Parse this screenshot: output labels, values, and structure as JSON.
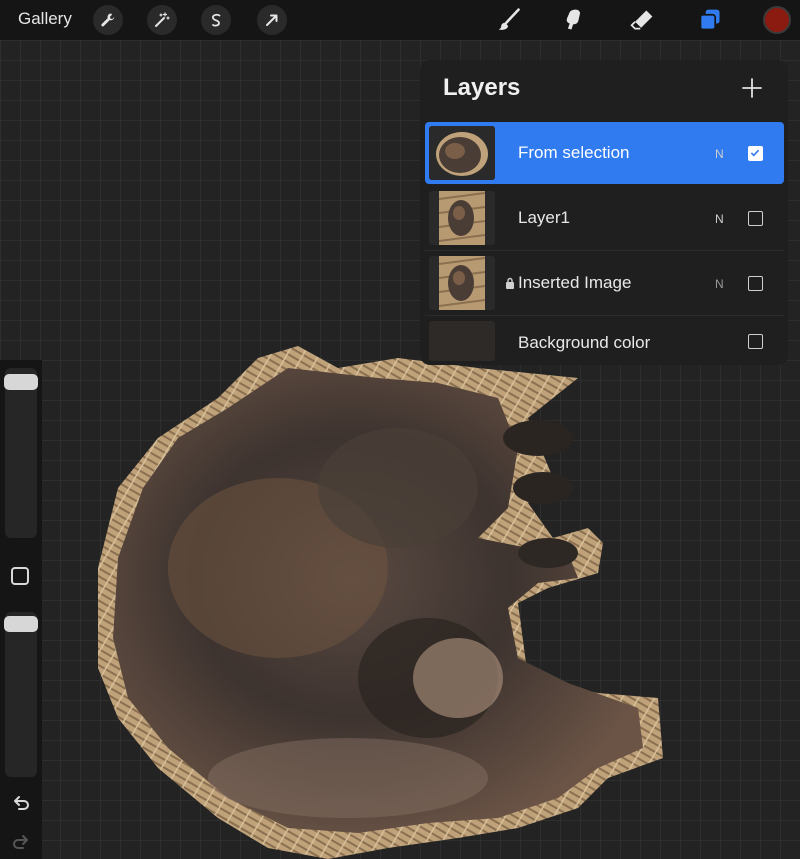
{
  "app": {
    "gallery_label": "Gallery"
  },
  "toolbar": {
    "left_tools": [
      {
        "icon": "wrench-icon"
      },
      {
        "icon": "magic-wand-icon"
      },
      {
        "icon": "selection-icon"
      },
      {
        "icon": "transform-arrow-icon"
      }
    ],
    "right_tools": [
      {
        "icon": "brush-icon"
      },
      {
        "icon": "smudge-icon"
      },
      {
        "icon": "eraser-icon"
      },
      {
        "icon": "layers-icon",
        "active": true
      }
    ],
    "current_color": "#8b1a10"
  },
  "layers": {
    "title": "Layers",
    "items": [
      {
        "name": "From selection",
        "blend": "N",
        "visible": true,
        "selected": true,
        "locked": false
      },
      {
        "name": "Layer1",
        "blend": "N",
        "visible": false,
        "selected": false,
        "locked": false
      },
      {
        "name": "Inserted Image",
        "blend": "N",
        "visible": false,
        "selected": false,
        "locked": true
      },
      {
        "name": "Background color",
        "blend": "",
        "visible": false,
        "selected": false,
        "locked": false
      }
    ]
  },
  "colors": {
    "accent": "#2f7bef",
    "panel": "#1f1f1f",
    "toolbar": "#151515"
  }
}
